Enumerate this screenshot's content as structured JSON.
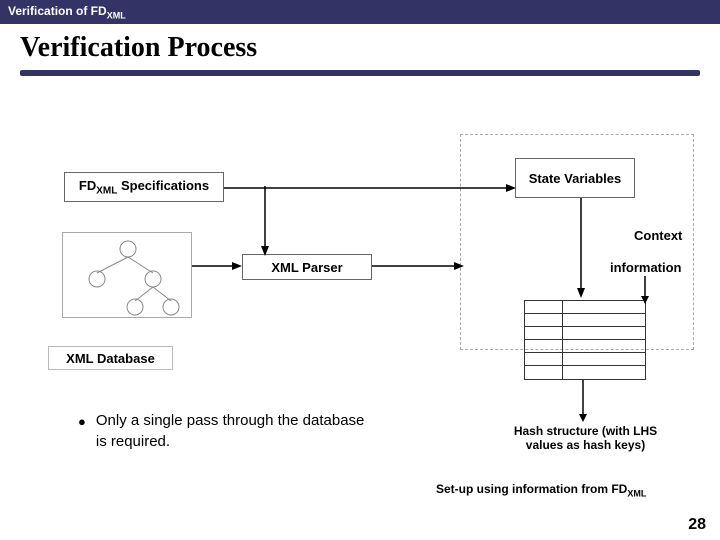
{
  "header": {
    "title_pre": "Verification of FD",
    "title_sub": "XML"
  },
  "title": "Verification Process",
  "boxes": {
    "spec_pre": "FD",
    "spec_sub": "XML",
    "spec_post": " Specifications",
    "state": "State Variables",
    "parser": "XML Parser",
    "db": "XML Database",
    "context": "Context",
    "information": "information"
  },
  "hash_caption_l1": "Hash structure (with LHS",
  "hash_caption_l2": "values as hash keys)",
  "bullet": "Only a single pass through the database is required.",
  "footer_pre": "Set-up using information from FD",
  "footer_sub": "XML",
  "page": "28"
}
